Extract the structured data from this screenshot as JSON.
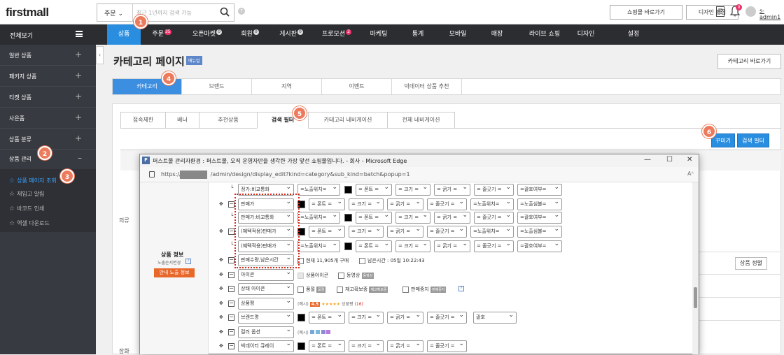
{
  "app": {
    "logo": "firstmall",
    "user": "s-admin1",
    "notif_count": "0"
  },
  "search": {
    "select_value": "주문",
    "placeholder": "최근 1년까지 검색 가능"
  },
  "header": {
    "shop_button": "쇼핑몰 바로가기",
    "design_button": "디자인 편집"
  },
  "nav": {
    "all_view": "전체보기",
    "items": [
      {
        "label": "상품",
        "badge": ""
      },
      {
        "label": "주문",
        "badge": "35"
      },
      {
        "label": "오픈마켓",
        "badge": "0"
      },
      {
        "label": "회원",
        "badge": "0"
      },
      {
        "label": "게시판",
        "badge": "0"
      },
      {
        "label": "프로모션",
        "badge": "2"
      },
      {
        "label": "마케팅",
        "badge": ""
      },
      {
        "label": "통계",
        "badge": ""
      },
      {
        "label": "모바일",
        "badge": ""
      },
      {
        "label": "매장",
        "badge": ""
      },
      {
        "label": "라이브 쇼핑",
        "badge": ""
      },
      {
        "label": "디자인",
        "badge": ""
      },
      {
        "label": "설정",
        "badge": ""
      }
    ]
  },
  "sidebar": {
    "items": [
      {
        "label": "일반 상품",
        "toggle": "+"
      },
      {
        "label": "패키지 상품",
        "toggle": "+"
      },
      {
        "label": "티켓 상품",
        "toggle": "+"
      },
      {
        "label": "사은품",
        "toggle": "+"
      },
      {
        "label": "상품 분류",
        "toggle": "+"
      },
      {
        "label": "상품 관리",
        "toggle": "–"
      }
    ],
    "subitems": [
      "상품 페이지 조회",
      "재입고 알림",
      "바코드 인쇄",
      "엑셀 다운로드"
    ]
  },
  "main": {
    "title": "카테고리 페이지",
    "manual_badge": "매뉴얼",
    "shortcut_button": "카테고리 바로가기",
    "tabs1": [
      "카테고리",
      "브랜드",
      "지역",
      "이벤트",
      "빅데이터 상품 추천"
    ],
    "tabs2": [
      "접속제한",
      "배너",
      "추천상품",
      "검색 필터",
      "카테고리 네비게이션",
      "전체 네비게이션"
    ],
    "decorate_button": "꾸미기",
    "search_filter_button": "검색 필터",
    "row_label_1": "의류",
    "row_label_2": "잡화",
    "sort_button": "상품 정렬"
  },
  "popup": {
    "title": "퍼스트몰 관리자환경 : 퍼스트몰, 오직 운영자만을 생각한 가장 앞선 쇼핑몰입니다. - 회사 - Microsoft Edge",
    "url_prefix": "https://",
    "url_path": "/admin/design/display_edit?kind=category&sub_kind=batch&popup=1",
    "aa": "Aᴬ",
    "product_info_title": "상품 정보",
    "product_info_sub": "노출순서변경",
    "product_info_button": "안내 노출 정보",
    "rows": [
      {
        "arrow": false,
        "minus": false,
        "field": "정가:비교통화",
        "sel2": "=노출위치=",
        "swatch": true,
        "sel3": "= 폰트 =",
        "sel4": "= 크기 =",
        "sel5": "= 굵기 =",
        "sel6": "= 줄긋기 =",
        "sel7": "=괄호여부="
      },
      {
        "arrow": true,
        "minus": true,
        "field": "판매가",
        "swatch0": true,
        "sel2": "= 폰트 =",
        "sel3": "= 크기 =",
        "sel4": "= 굵기 =",
        "sel5": "= 줄긋기 =",
        "sel6": "=노출위치=",
        "sel7": "=노출심볼="
      },
      {
        "arrow": false,
        "minus": false,
        "field": "판매가:비교통화",
        "sel2": "=노출위치=",
        "swatch": true,
        "sel3": "= 폰트 =",
        "sel4": "= 크기 =",
        "sel5": "= 굵기 =",
        "sel6": "= 줄긋기 =",
        "sel7": "=괄호여부="
      },
      {
        "arrow": true,
        "minus": true,
        "field": "(혜택적용)판매가",
        "swatch0": true,
        "sel2": "= 폰트 =",
        "sel3": "= 크기 =",
        "sel4": "= 굵기 =",
        "sel5": "= 줄긋기 =",
        "sel6": "=노출위치=",
        "sel7": "=노출심볼="
      },
      {
        "arrow": false,
        "minus": false,
        "field": "(혜택적용)판매가",
        "sel2": "=노출위치=",
        "swatch": true,
        "sel3": "= 폰트 =",
        "sel4": "= 크기 =",
        "sel5": "= 굵기 =",
        "sel6": "= 줄긋기 =",
        "sel7": "=괄호여부="
      }
    ],
    "row_sales": {
      "field": "판매수량,남은시간",
      "note1": "현재 11,905개 구매",
      "note2": "남은시간 : 05일 10:22:43"
    },
    "row_icon": {
      "field": "아이콘",
      "opt1": "상품아이콘",
      "opt2": "동영상",
      "tag2": "동영상"
    },
    "row_status": {
      "field": "상태 아이콘",
      "opt1": "품절",
      "tag1": "품절",
      "opt2": "재고확보중",
      "tag2": "재고확보중",
      "opt3": "판매중지",
      "tag3": "판매중지"
    },
    "row_review": {
      "field": "상품평",
      "example": "(예시)",
      "score": "4.5",
      "stars": "★★★★★",
      "label": "상품평",
      "count": "(16)"
    },
    "row_brand": {
      "field": "브랜드명",
      "sel2": "= 폰트 =",
      "sel3": "= 크기 =",
      "sel4": "= 굵기 =",
      "sel5": "= 줄긋기 =",
      "sel6": "괄호"
    },
    "row_color": {
      "field": "컬러 옵션",
      "example": "(예시)"
    },
    "row_bigdata": {
      "field": "빅데이터 큐레이",
      "sel2": "= 폰트 =",
      "sel3": "= 크기 =",
      "sel4": "= 굵기 =",
      "sel5": "= 줄긋기 ="
    }
  },
  "steps": [
    "1",
    "2",
    "3",
    "4",
    "5",
    "6"
  ],
  "colors": {
    "accent": "#2a8ee0",
    "nav_bg": "#2c2d31",
    "sidebar_bg": "#373a40",
    "step": "#ec7a5c",
    "highlight": "#d8291a",
    "orange_btn": "#e8682a"
  }
}
